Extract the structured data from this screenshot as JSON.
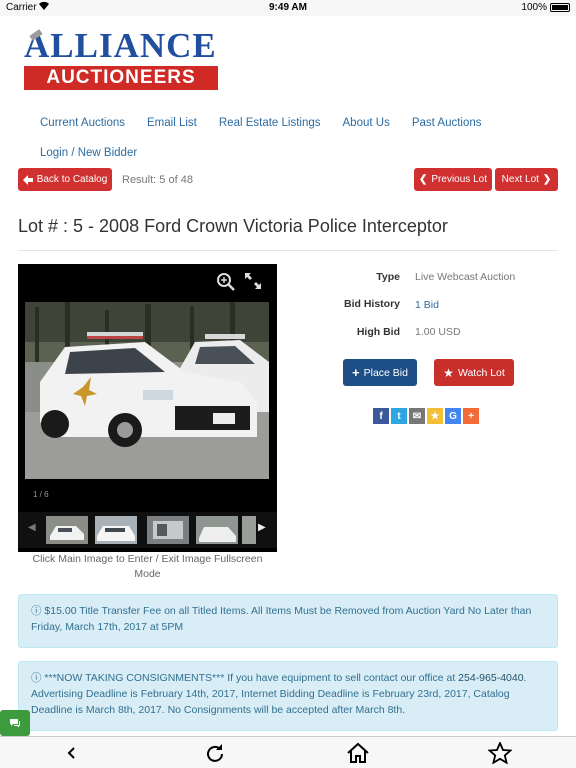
{
  "status_bar": {
    "carrier": "Carrier",
    "time": "9:49 AM",
    "battery": "100%"
  },
  "logo": {
    "top_text": "ALLIANCE",
    "bar_text": "AUCTIONEERS"
  },
  "nav": {
    "items": [
      "Current Auctions",
      "Email List",
      "Real Estate Listings",
      "About Us",
      "Past Auctions",
      "Login / New Bidder"
    ]
  },
  "catalog": {
    "back_label": "Back to Catalog",
    "result_text": "Result: 5 of 48",
    "prev_label": "Previous Lot",
    "next_label": "Next Lot"
  },
  "lot": {
    "title": "Lot # : 5 - 2008 Ford Crown Victoria Police Interceptor",
    "image_counter": "1 / 6",
    "caption": "Click Main Image to Enter / Exit Image Fullscreen Mode",
    "type_label": "Type",
    "type_value": "Live Webcast Auction",
    "bid_history_label": "Bid History",
    "bid_history_value": "1 Bid",
    "high_bid_label": "High Bid",
    "high_bid_value": "1.00 USD",
    "place_bid_label": "Place Bid",
    "watch_lot_label": "Watch Lot"
  },
  "share_icons": [
    "facebook-icon",
    "twitter-icon",
    "email-icon",
    "favorite-icon",
    "google-icon",
    "more-icon"
  ],
  "alerts": [
    {
      "text": "$15.00 Title Transfer Fee on all Titled Items. All Items Must be Removed from Auction Yard No Later than Friday, March 17th, 2017 at 5PM"
    },
    {
      "text_before": "***NOW TAKING CONSIGNMENTS*** If you have equipment to sell contact our office at ",
      "phone": "254-965-4040",
      "text_after": ". Advertising Deadline is February 14th, 2017, Internet Bidding Deadline is February 23rd, 2017, Catalog Deadline is March 8th, 2017. No Consignments will be accepted after March 8th."
    }
  ],
  "colors": {
    "brand_blue": "#1f4f9e",
    "brand_red": "#d02a26",
    "link": "#2d6ca2",
    "alert_bg": "#d9edf7",
    "place_bid": "#1d4f86"
  }
}
